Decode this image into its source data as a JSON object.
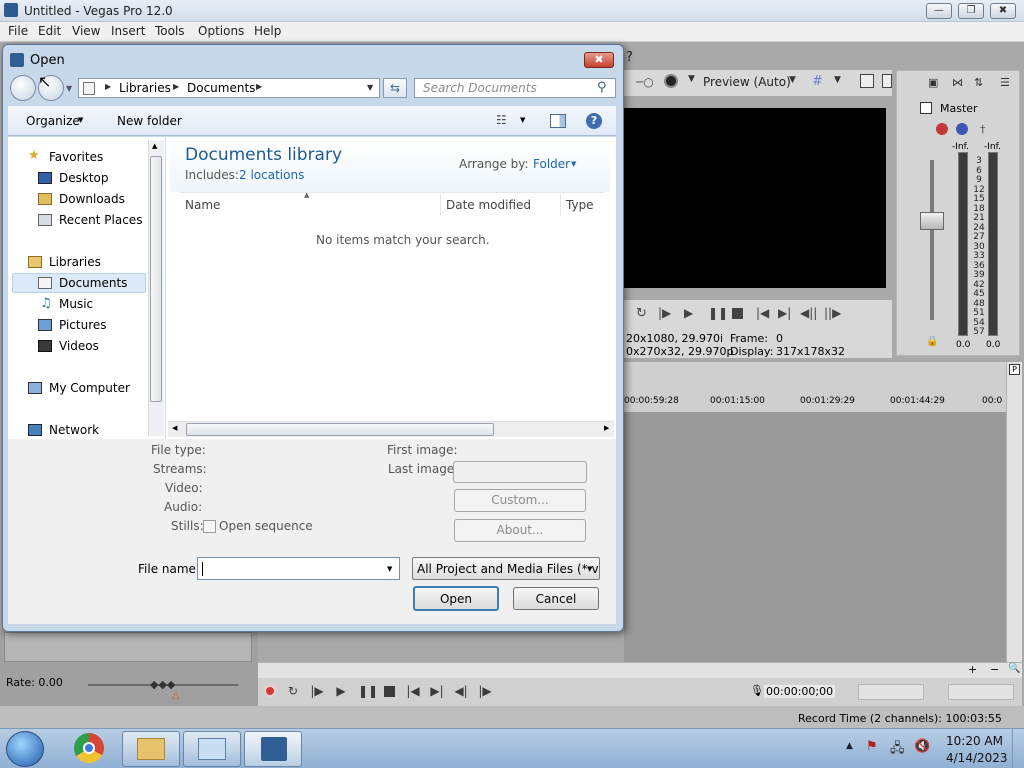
{
  "app": {
    "title": "Untitled - Vegas Pro 12.0",
    "menu": [
      "File",
      "Edit",
      "View",
      "Insert",
      "Tools",
      "Options",
      "Help"
    ],
    "minimize": "—",
    "maximize": "❐",
    "close": "✖"
  },
  "preview": {
    "mode": "Preview (Auto)",
    "line1_left": "20x1080, 29.970i",
    "line1_mid_label": "Frame:",
    "line1_mid_value": "0",
    "line2_left": "0x270x32, 29.970p",
    "line2_mid_label": "Display:",
    "line2_mid_value": "317x178x32"
  },
  "mixer": {
    "title": "Master",
    "left_level": "-Inf.",
    "right_level": "-Inf.",
    "scale": [
      "3",
      "6",
      "9",
      "12",
      "15",
      "18",
      "21",
      "24",
      "27",
      "30",
      "33",
      "36",
      "39",
      "42",
      "45",
      "48",
      "51",
      "54",
      "57"
    ],
    "left_value": "0.0",
    "right_value": "0.0"
  },
  "timeline": {
    "ruler": [
      "00:00:59:28",
      "00:01:15:00",
      "00:01:29:29",
      "00:01:44:29",
      "00:0"
    ],
    "timecode": "00:00:00;00",
    "rate": "Rate: 0.00",
    "record_time": "Record Time (2 channels): 100:03:55"
  },
  "taskbar": {
    "time": "10:20 AM",
    "date": "4/14/2023"
  },
  "dialog": {
    "title": "Open",
    "close": "✖",
    "breadcrumb": [
      "Libraries",
      "Documents"
    ],
    "search_placeholder": "Search Documents",
    "organize": "Organize",
    "new_folder": "New folder",
    "nav": {
      "favorites": "Favorites",
      "favorites_items": [
        "Desktop",
        "Downloads",
        "Recent Places"
      ],
      "libraries": "Libraries",
      "libraries_items": [
        "Documents",
        "Music",
        "Pictures",
        "Videos"
      ],
      "computer": "My Computer",
      "network": "Network"
    },
    "library_title": "Documents library",
    "includes_label": "Includes:",
    "includes_link": "2 locations",
    "arrange_label": "Arrange by:",
    "arrange_value": "Folder",
    "columns": [
      "Name",
      "Date modified",
      "Type"
    ],
    "empty_message": "No items match your search.",
    "info": {
      "file_type": "File type:",
      "streams": "Streams:",
      "video": "Video:",
      "audio": "Audio:",
      "stills": "Stills:",
      "open_sequence": "Open sequence",
      "first_image": "First image:",
      "last_image": "Last image:",
      "custom": "Custom...",
      "about": "About..."
    },
    "file_name_label": "File name:",
    "file_name_value": "",
    "filter": "All Project and Media Files (*.ve",
    "open_button": "Open",
    "cancel_button": "Cancel"
  }
}
